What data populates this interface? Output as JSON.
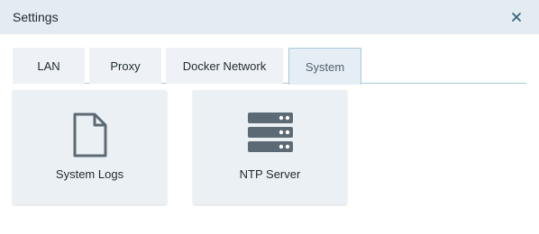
{
  "window": {
    "title": "Settings",
    "close_icon": "close-icon"
  },
  "tabs": [
    {
      "label": "LAN",
      "active": false
    },
    {
      "label": "Proxy",
      "active": false
    },
    {
      "label": "Docker Network",
      "active": false
    },
    {
      "label": "System",
      "active": true
    }
  ],
  "cards": [
    {
      "label": "System Logs",
      "icon": "document-icon"
    },
    {
      "label": "NTP Server",
      "icon": "server-icon"
    }
  ],
  "colors": {
    "titlebar_bg": "#e4ebf1",
    "tab_bg": "#eef2f6",
    "active_tab_border": "#a9c8d8",
    "card_bg": "#ebf0f4",
    "icon": "#5c6a75"
  }
}
